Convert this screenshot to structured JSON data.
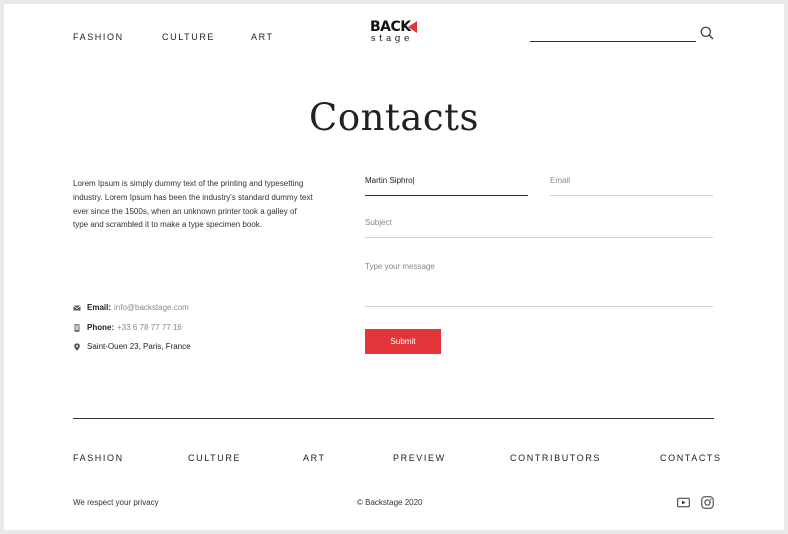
{
  "header": {
    "nav": [
      "FASHION",
      "CULTURE",
      "ART"
    ],
    "logo_top": "BACK",
    "logo_bottom": "stage",
    "search_icon": "search-icon"
  },
  "page": {
    "title": "Contacts",
    "description": "Lorem Ipsum is simply dummy text of the printing and typesetting industry. Lorem Ipsum has been the industry's standard dummy text ever since the 1500s, when an unknown printer took a galley of type and scrambled it to make a type specimen book."
  },
  "contacts": {
    "email_label": "Email:",
    "email_value": "info@backstage.com",
    "phone_label": "Phone:",
    "phone_value": "+33 6 78 77 77 16",
    "address": "Saint-Ouen 23, Paris, France"
  },
  "form": {
    "name_value": "Martin Siphro|",
    "email_placeholder": "Email",
    "subject_placeholder": "Subject",
    "message_placeholder": "Type your message",
    "submit_label": "Submit"
  },
  "footer": {
    "nav": [
      "FASHION",
      "CULTURE",
      "ART",
      "PREVIEW",
      "CONTRIBUTORS",
      "CONTACTS"
    ],
    "privacy": "We respect your privacy",
    "copyright": "© Backstage 2020",
    "social_icons": [
      "youtube-icon",
      "instagram-icon"
    ]
  },
  "colors": {
    "accent": "#e3363a",
    "text": "#222222",
    "muted": "#8a8a8a"
  }
}
